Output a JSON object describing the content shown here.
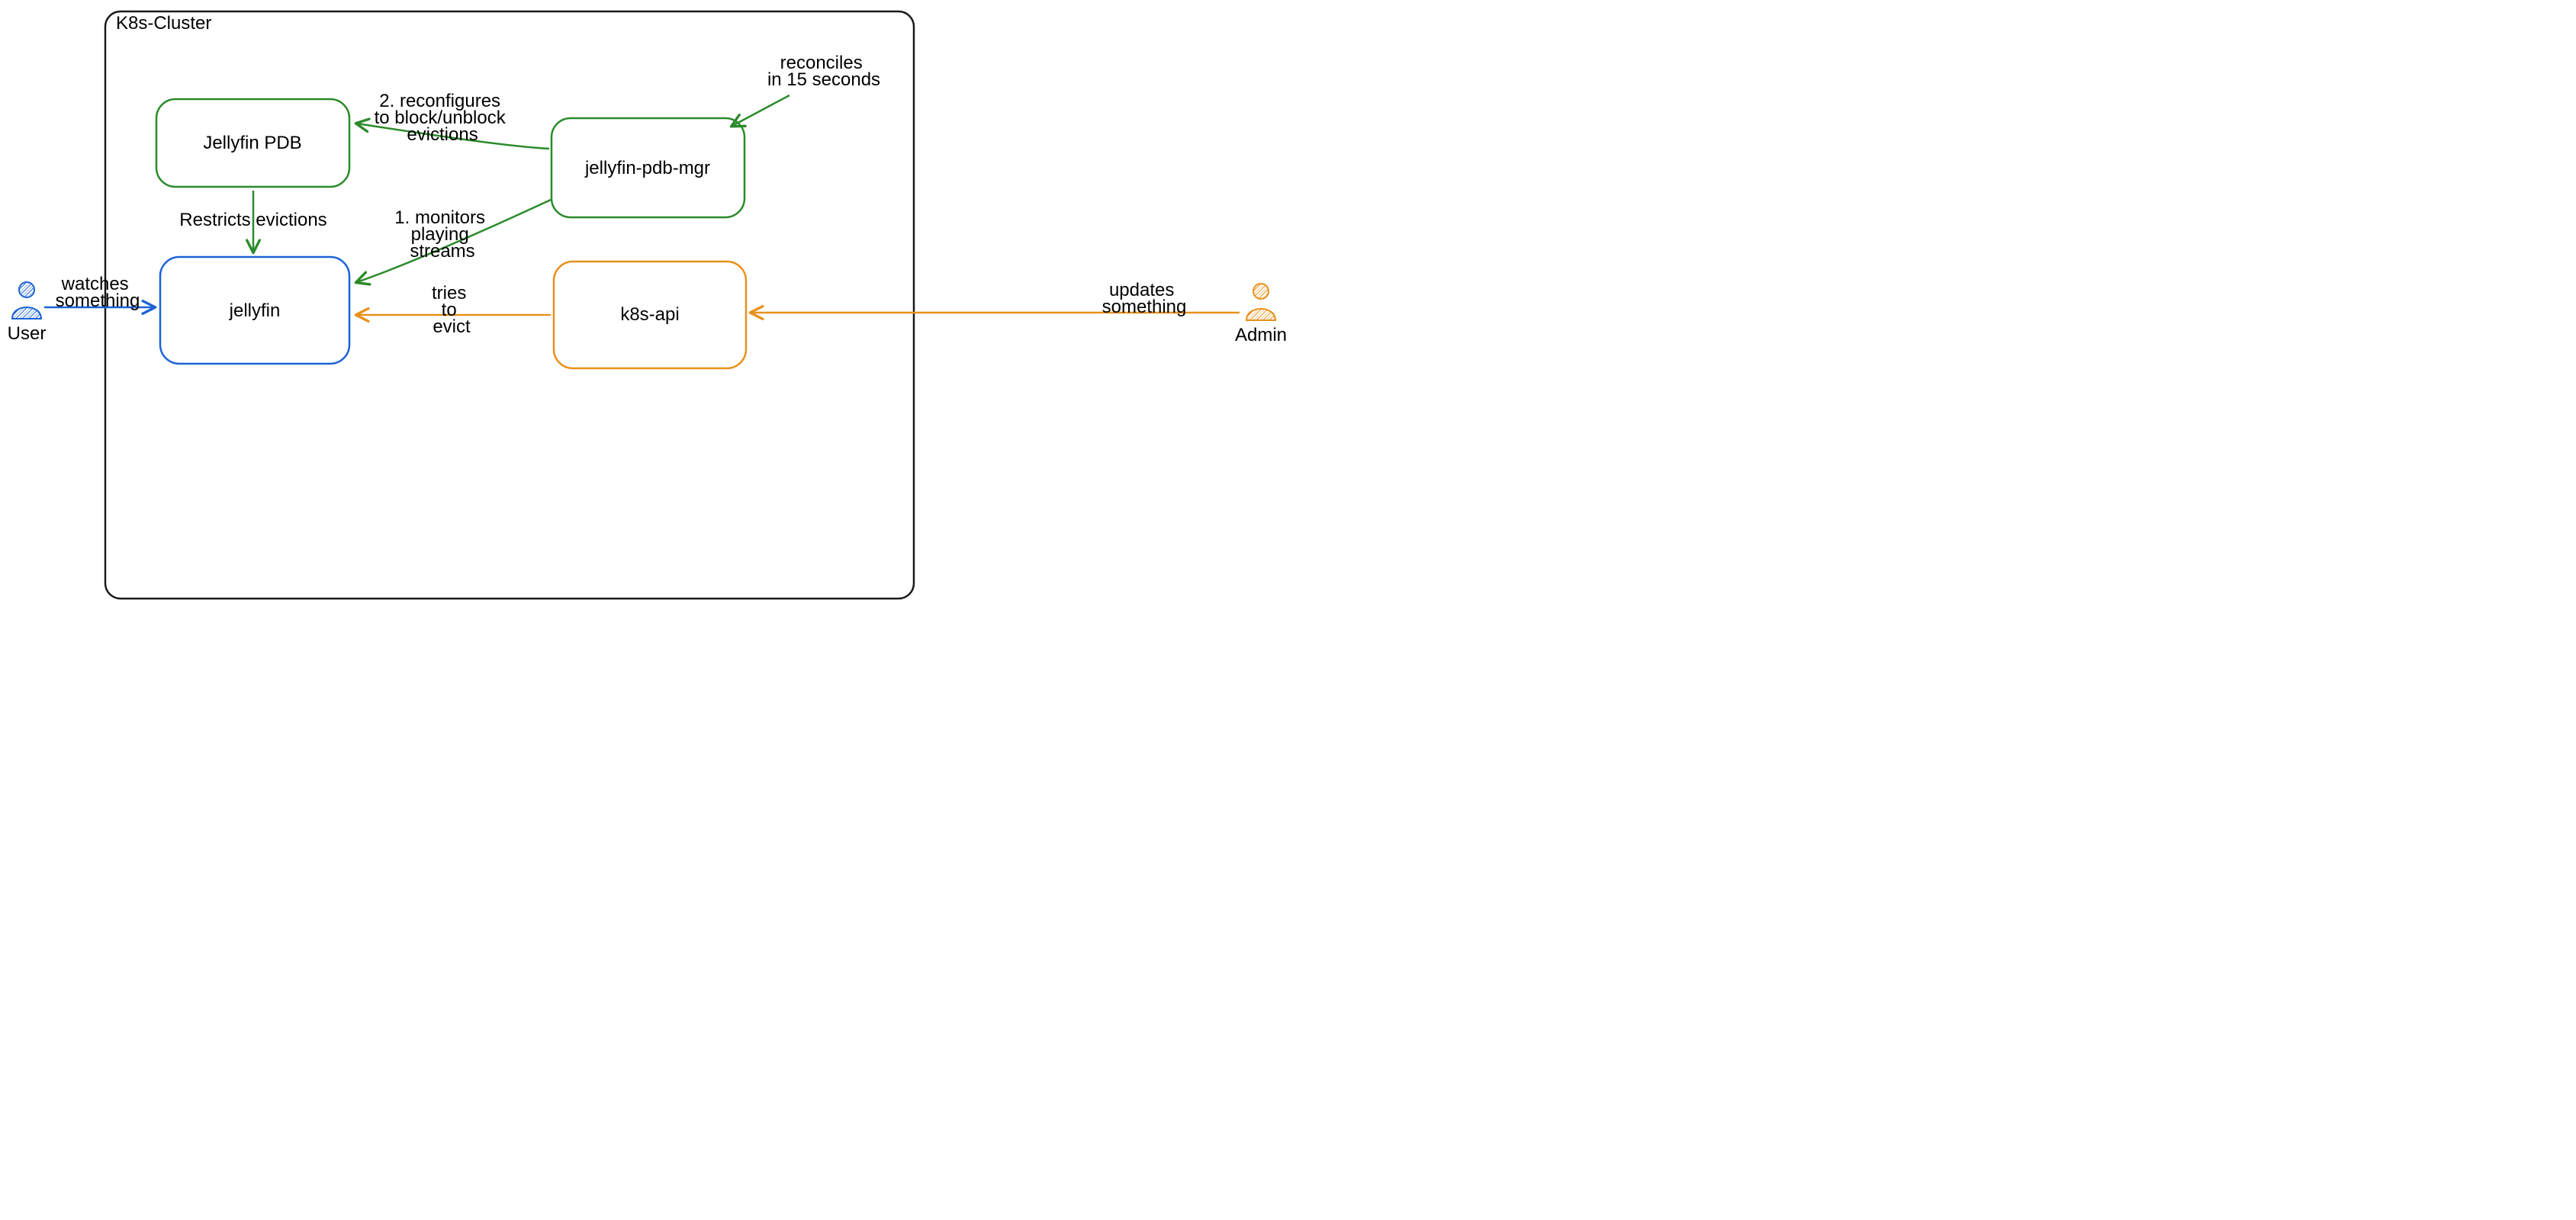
{
  "cluster": {
    "title": "K8s-Cluster"
  },
  "actors": {
    "user": {
      "label": "User"
    },
    "admin": {
      "label": "Admin"
    }
  },
  "nodes": {
    "pdb": {
      "label": "Jellyfin PDB"
    },
    "mgr": {
      "label": "jellyfin-pdb-mgr"
    },
    "jellyfin": {
      "label": "jellyfin"
    },
    "k8sapi": {
      "label": "k8s-api"
    }
  },
  "edges": {
    "user_to_jellyfin": {
      "l1": "watches",
      "l2": "something"
    },
    "admin_to_k8sapi": {
      "l1": "updates",
      "l2": "something"
    },
    "pdb_to_jellyfin": {
      "label": "Restricts evictions"
    },
    "mgr_to_pdb": {
      "l1": "2. reconfigures",
      "l2": "to block/unblock",
      "l3": "evictions"
    },
    "mgr_to_jellyfin": {
      "l1": "1. monitors",
      "l2": "playing",
      "l3": "streams"
    },
    "mgr_self": {
      "l1": "reconciles",
      "l2": "in 15 seconds"
    },
    "k8sapi_to_jellyfin": {
      "l1": "tries",
      "l2": "to",
      "l3": "evict"
    }
  },
  "colors": {
    "black": "#1a1a1a",
    "blue": "#1c63d6",
    "green": "#2b8a2b",
    "orange": "#e8911b"
  }
}
